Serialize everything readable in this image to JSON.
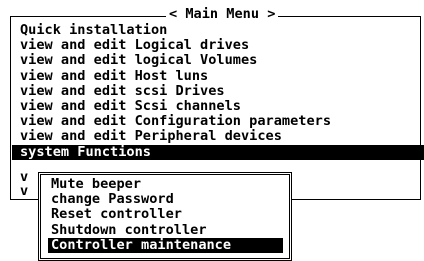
{
  "main_menu": {
    "title": "< Main Menu >",
    "items": [
      {
        "label": "Quick installation"
      },
      {
        "label": "view and edit Logical drives"
      },
      {
        "label": "view and edit logical Volumes"
      },
      {
        "label": "view and edit Host luns"
      },
      {
        "label": "view and edit scsi Drives"
      },
      {
        "label": "view and edit Scsi channels"
      },
      {
        "label": "view and edit Configuration parameters"
      },
      {
        "label": "view and edit Peripheral devices"
      },
      {
        "label": "system Functions",
        "selected": true
      }
    ],
    "obscured_item_prefixes": [
      "v",
      "v"
    ]
  },
  "submenu": {
    "items": [
      {
        "label": "Mute beeper"
      },
      {
        "label": "change Password"
      },
      {
        "label": "Reset controller"
      },
      {
        "label": "Shutdown controller"
      },
      {
        "label": "Controller maintenance",
        "selected": true
      }
    ]
  },
  "colors": {
    "background": "#ffffff",
    "foreground": "#000000",
    "highlight_bg": "#000000",
    "highlight_fg": "#ffffff"
  }
}
